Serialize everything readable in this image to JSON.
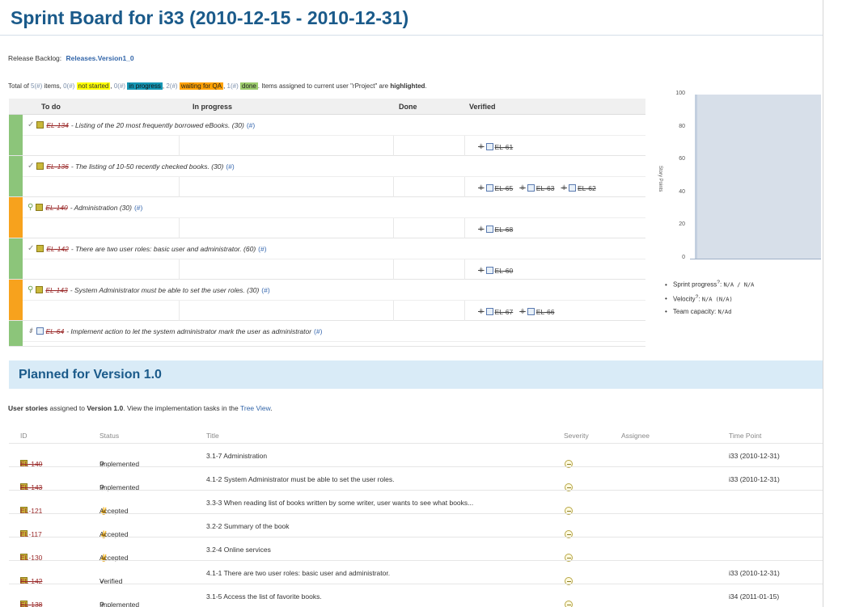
{
  "board": {
    "title": "Sprint Board for i33 (2010-12-15 - 2010-12-31)",
    "release_label": "Release Backlog:",
    "release_link": "Releases.Version1_0",
    "totals": {
      "prefix": "Total of",
      "total_count": "5(#)",
      "items_word": "items,",
      "ns_count": "0(#)",
      "ns_label": "not started",
      "ip_count": "0(#)",
      "ip_label": "in progress",
      "wq_count": "2(#)",
      "wq_label": "waiting for QA",
      "dn_count": "1(#)",
      "dn_label": "done",
      "suffix_a": ". Items assigned to current user \"rProject\" are",
      "highlighted": "highlighted",
      "suffix_b": "."
    },
    "columns": {
      "todo": "To do",
      "progress": "In progress",
      "done": "Done",
      "verified": "Verified"
    },
    "stories": [
      {
        "id": "EL-134",
        "text": "- Listing of the 20 most frequently borrowed eBooks. (30)",
        "hash": "(#)",
        "state": "verified",
        "tasks": [
          "EL-61"
        ]
      },
      {
        "id": "EL-136",
        "text": "- The listing of 10-50 recently checked books. (30)",
        "hash": "(#)",
        "state": "verified",
        "tasks": [
          "EL-65",
          "EL-63",
          "EL-62"
        ]
      },
      {
        "id": "EL-140",
        "text": "- Administration (30)",
        "hash": "(#)",
        "state": "implemented",
        "tasks": [
          "EL-68"
        ]
      },
      {
        "id": "EL-142",
        "text": "- There are two user roles: basic user and administrator. (60)",
        "hash": "(#)",
        "state": "verified",
        "tasks": [
          "EL-60"
        ]
      },
      {
        "id": "EL-143",
        "text": "- System Administrator must be able to set the user roles. (30)",
        "hash": "(#)",
        "state": "implemented",
        "tasks": [
          "EL-67",
          "EL-66"
        ]
      }
    ],
    "task_story": {
      "id": "EL-64",
      "text": "- Implement action to let the system administrator mark the user as administrator",
      "hash": "(#)"
    }
  },
  "chart_data": {
    "type": "bar",
    "ylabel": "Story Points",
    "ylim": [
      0,
      100
    ],
    "yticks": [
      "100",
      "80",
      "60",
      "40",
      "20",
      "0"
    ],
    "values": [
      100
    ]
  },
  "stats": {
    "progress_label": "Sprint progress",
    "progress_sup": "?",
    "progress_value": "N/A / N/A",
    "velocity_label": "Velocity",
    "velocity_sup": "?",
    "velocity_value": "N/A (N/A)",
    "capacity_label": "Team capacity:",
    "capacity_value": "N/Ad"
  },
  "planned": {
    "title": "Planned for Version 1.0",
    "line": {
      "a": "User stories",
      "b": " assigned to ",
      "version": "Version 1.0",
      "c": ". View the implementation tasks in the ",
      "link": "Tree View",
      "d": "."
    },
    "headers": {
      "id": "ID",
      "status": "Status",
      "title": "Title",
      "severity": "Severity",
      "assignee": "Assignee",
      "time_point": "Time Point"
    },
    "rows": [
      {
        "id": "EL-140",
        "strike": true,
        "status": "Implemented",
        "status_kind": "impl",
        "title": "3.1-7 Administration",
        "time_point": "i33 (2010-12-31)"
      },
      {
        "id": "EL-143",
        "strike": true,
        "status": "Implemented",
        "status_kind": "impl",
        "title": "4.1-2 System Administrator must be able to set the user roles.",
        "time_point": "i33 (2010-12-31)"
      },
      {
        "id": "EL-121",
        "strike": false,
        "status": "Accepted",
        "status_kind": "acc",
        "title": "3.3-3 When reading list of books written by some writer, user wants to see what books...",
        "time_point": ""
      },
      {
        "id": "EL-117",
        "strike": false,
        "status": "Accepted",
        "status_kind": "acc",
        "title": "3.2-2 Summary of the book",
        "time_point": ""
      },
      {
        "id": "EL-130",
        "strike": false,
        "status": "Accepted",
        "status_kind": "acc",
        "title": "3.2-4 Online services",
        "time_point": ""
      },
      {
        "id": "EL-142",
        "strike": true,
        "status": "Verified",
        "status_kind": "ver",
        "title": "4.1-1 There are two user roles: basic user and administrator.",
        "time_point": "i33 (2010-12-31)"
      },
      {
        "id": "EL-138",
        "strike": true,
        "status": "Implemented",
        "status_kind": "impl",
        "title": "3.1-5 Access the list of favorite books.",
        "time_point": "i34 (2011-01-15)"
      }
    ]
  }
}
